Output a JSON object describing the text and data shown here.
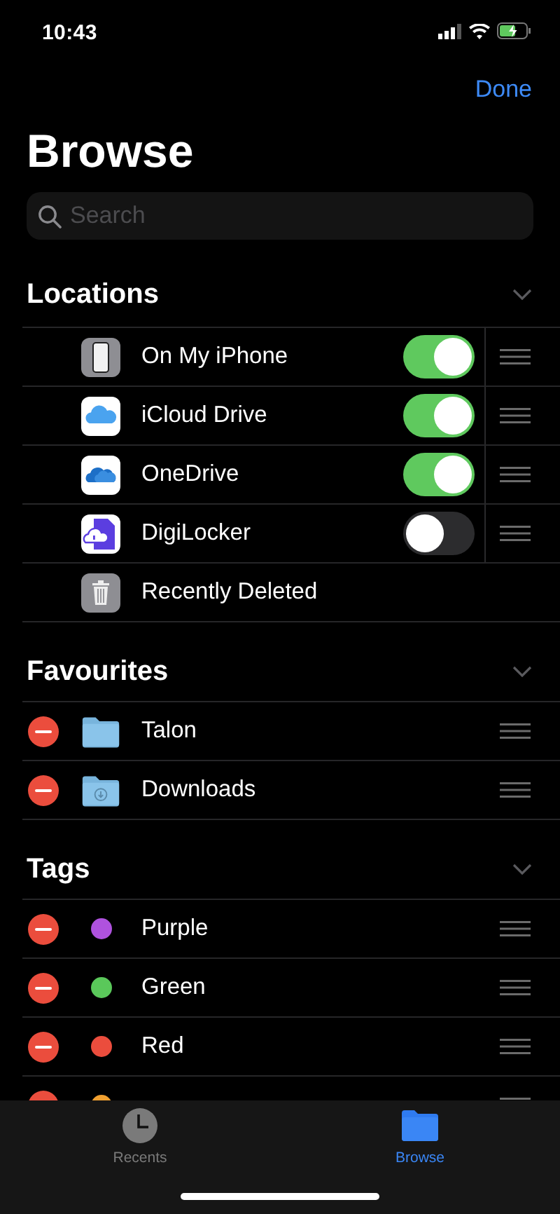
{
  "status_bar": {
    "time": "10:43"
  },
  "nav": {
    "done": "Done",
    "title": "Browse"
  },
  "search": {
    "placeholder": "Search"
  },
  "sections": [
    {
      "title": "Locations",
      "kind": "locations",
      "expanded": true,
      "items": [
        {
          "label": "On My iPhone",
          "kind": "phone",
          "on": true
        },
        {
          "label": "iCloud Drive",
          "kind": "icloud",
          "on": true
        },
        {
          "label": "OneDrive",
          "kind": "onedrive",
          "on": true
        },
        {
          "label": "DigiLocker",
          "kind": "locker",
          "on": false
        },
        {
          "label": "Recently Deleted",
          "kind": "trash"
        }
      ]
    },
    {
      "title": "Favourites",
      "kind": "favourites",
      "expanded": true,
      "items": [
        {
          "label": "Talon",
          "kind": "folder"
        },
        {
          "label": "Downloads",
          "kind": "downloads"
        }
      ]
    },
    {
      "title": "Tags",
      "kind": "tags",
      "expanded": true,
      "items": [
        {
          "label": "Purple",
          "color": "#af52de"
        },
        {
          "label": "Green",
          "color": "#5ac85a"
        },
        {
          "label": "Red",
          "color": "#eb4d3d"
        },
        {
          "color": "#f0a030"
        }
      ]
    }
  ],
  "tabs": [
    {
      "label": "Recents",
      "kind": "clock",
      "selected": false
    },
    {
      "label": "Browse",
      "kind": "folder",
      "selected": true
    }
  ]
}
